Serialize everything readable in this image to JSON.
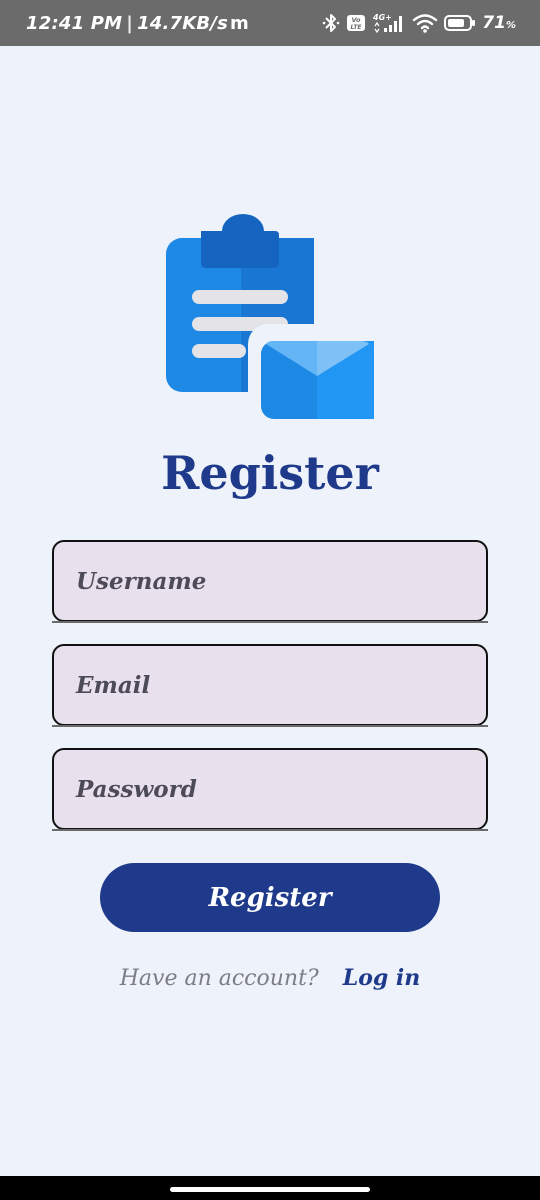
{
  "status_bar": {
    "time": "12:41 PM",
    "separator": "|",
    "network_speed": "14.7KB/s",
    "app_icon": "m",
    "battery_percent": "71",
    "battery_unit": "%",
    "network_label": "4G+",
    "volte_label": "Vo LTE"
  },
  "logo": {
    "icon": "clipboard-envelope-icon",
    "colors": {
      "primary": "#1e88e5",
      "dark": "#1565c0",
      "light": "#64b5f6",
      "lines": "#e3e3e8"
    }
  },
  "title": "Register",
  "form": {
    "username_placeholder": "Username",
    "email_placeholder": "Email",
    "password_placeholder": "Password"
  },
  "register_button_label": "Register",
  "account_prompt": {
    "question": "Have an account?",
    "link": "Log in"
  },
  "colors": {
    "background": "#eef2fb",
    "brand": "#1f3a8a",
    "field_fill": "#e8e0ec",
    "status_bar": "#6b6b6b"
  }
}
